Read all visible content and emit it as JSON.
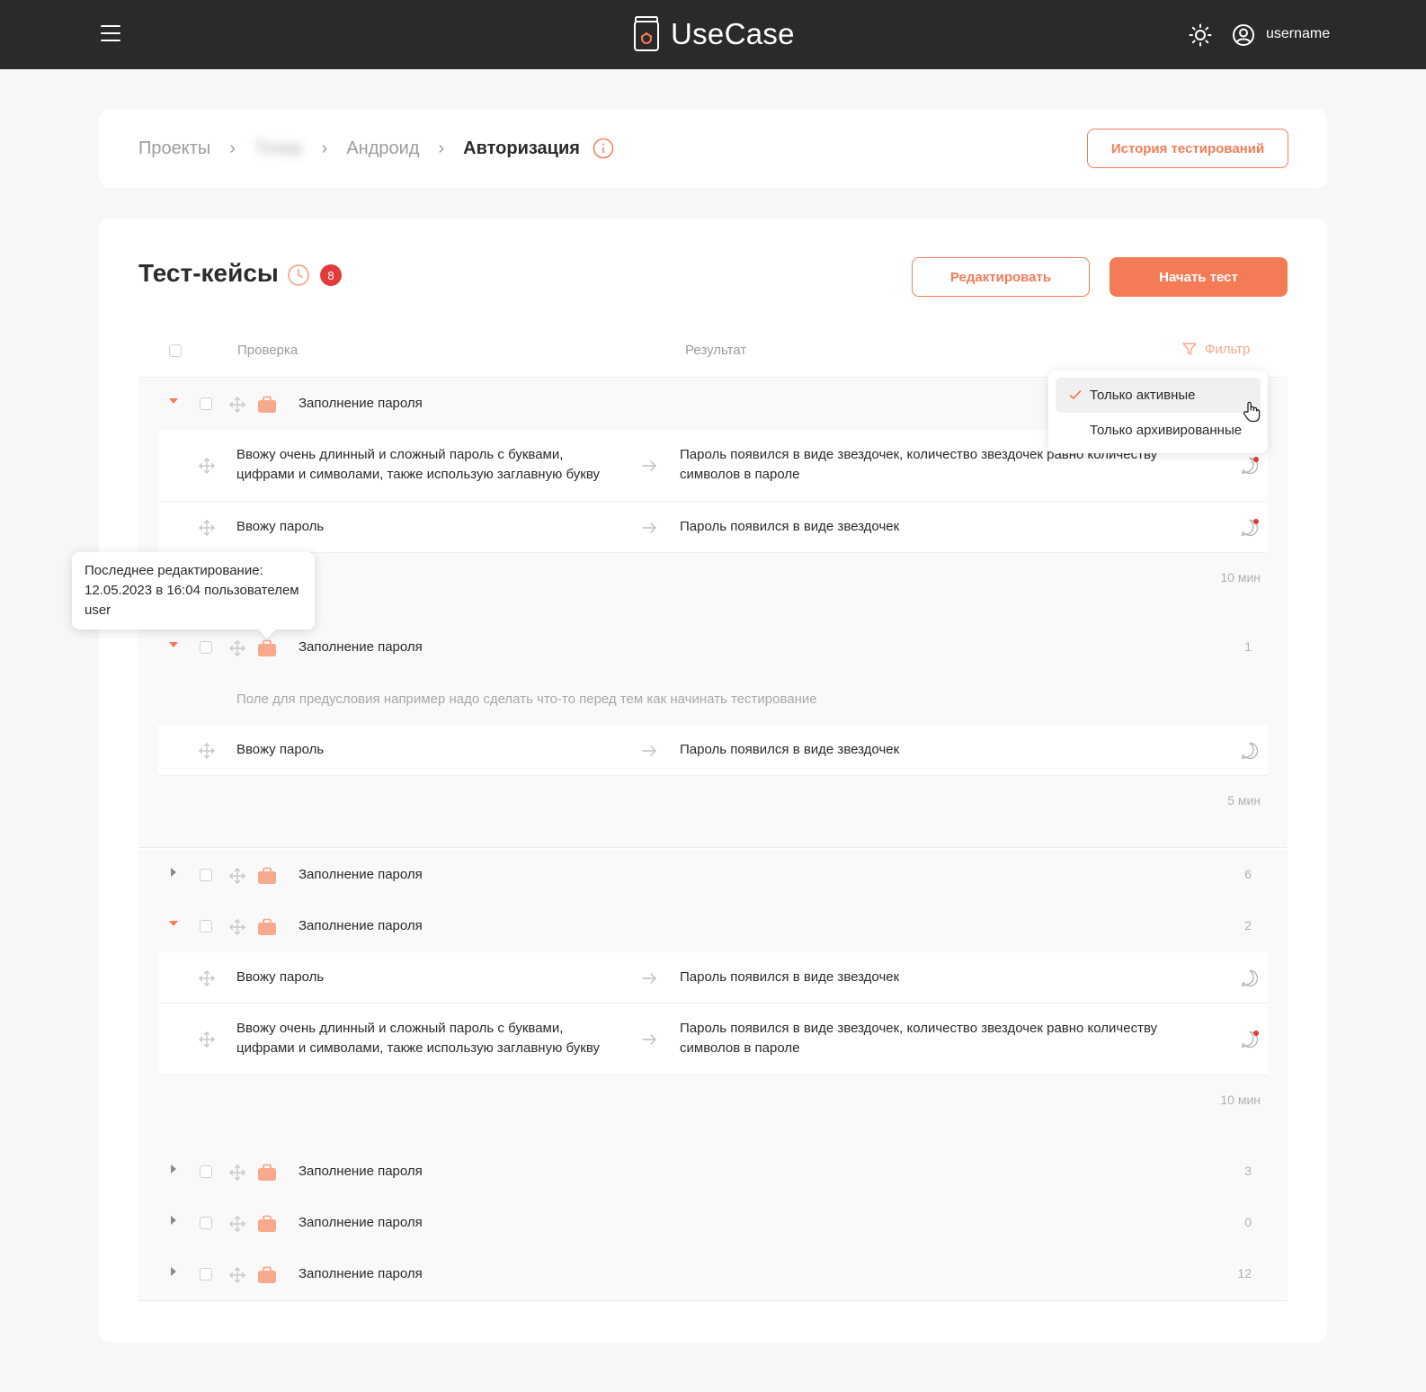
{
  "header": {
    "app_name": "UseCase",
    "username": "username"
  },
  "breadcrumb": {
    "items": [
      "Проекты",
      "Тизер",
      "Андроид",
      "Авторизация"
    ]
  },
  "history_button": "История тестирований",
  "section": {
    "title": "Тест-кейсы",
    "badge_count": "8",
    "edit_button": "Редактировать",
    "start_button": "Начать тест"
  },
  "table": {
    "col_check": "Проверка",
    "col_result": "Результат",
    "filter_label": "Фильтр"
  },
  "filter_menu": {
    "items": [
      "Только активные",
      "Только архивированные"
    ],
    "selected": "Только активные"
  },
  "tooltip": {
    "line1": "Последнее редактирование:",
    "line2": "12.05.2023 в 16:04 пользователем",
    "line3": "user"
  },
  "groups": [
    {
      "name": "Заполнение пароля",
      "count": "",
      "expanded": true,
      "steps": [
        {
          "check_line1": "Ввожу очень длинный и сложный пароль с буквами,",
          "check_line2": "цифрами и символами, также использую заглавную букву",
          "result_line1": "Пароль появился в виде звездочек, количество звездочек равно количеству",
          "result_line2": "символов в пароле",
          "has_new_comment": true
        },
        {
          "check_line1": "Ввожу пароль",
          "check_line2": "",
          "result_line1": "Пароль появился в виде звездочек",
          "result_line2": "",
          "has_new_comment": true
        }
      ],
      "duration": "10 мин"
    },
    {
      "name": "Заполнение пароля",
      "count": "1",
      "expanded": true,
      "precondition": "Поле для предусловия например надо сделать что-то перед тем как начинать тестирование",
      "steps": [
        {
          "check_line1": "Ввожу пароль",
          "check_line2": "",
          "result_line1": "Пароль появился в виде звездочек",
          "result_line2": "",
          "has_new_comment": false
        }
      ],
      "duration": "5 мин"
    },
    {
      "name": "Заполнение пароля",
      "count": "6",
      "expanded": false
    },
    {
      "name": "Заполнение пароля",
      "count": "2",
      "expanded": true,
      "steps": [
        {
          "check_line1": "Ввожу пароль",
          "check_line2": "",
          "result_line1": "Пароль появился в виде звездочек",
          "result_line2": "",
          "has_new_comment": false
        },
        {
          "check_line1": "Ввожу очень длинный и сложный пароль с буквами,",
          "check_line2": "цифрами и символами, также использую заглавную букву",
          "result_line1": "Пароль появился в виде звездочек, количество звездочек равно количеству",
          "result_line2": "символов в пароле",
          "has_new_comment": true
        }
      ],
      "duration": "10 мин"
    },
    {
      "name": "Заполнение пароля",
      "count": "3",
      "expanded": false
    },
    {
      "name": "Заполнение пароля",
      "count": "0",
      "expanded": false
    },
    {
      "name": "Заполнение пароля",
      "count": "12",
      "expanded": false
    }
  ],
  "colors": {
    "accent": "#f37c57",
    "topbar": "#2a2a2a",
    "badge": "#e23b3b",
    "folder": "#f7a98d"
  },
  "icons": [
    "menu-icon",
    "logo-icon",
    "sun-icon",
    "user-icon",
    "chevron-right-icon",
    "info-icon",
    "clock-icon",
    "filter-icon",
    "check-icon",
    "caret-icon",
    "drag-icon",
    "folder-icon",
    "arrow-right-icon",
    "comment-icon",
    "hand-cursor-icon"
  ]
}
